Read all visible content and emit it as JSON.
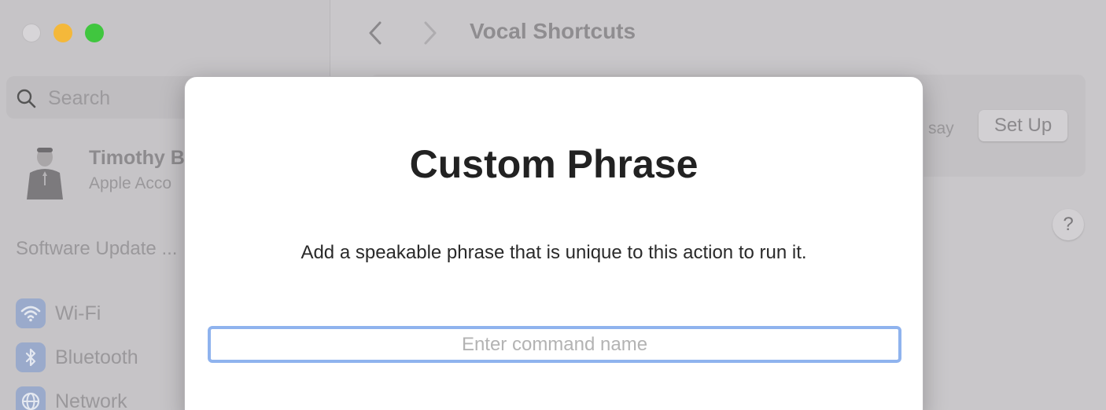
{
  "window": {
    "title": "Vocal Shortcuts"
  },
  "sidebar": {
    "search_placeholder": "Search",
    "user": {
      "name": "Timothy B",
      "subtitle": "Apple Acco"
    },
    "software_update": "Software Update ...",
    "items": [
      {
        "label": "Wi-Fi",
        "icon": "wifi-icon"
      },
      {
        "label": "Bluetooth",
        "icon": "bluetooth-icon"
      },
      {
        "label": "Network",
        "icon": "network-icon"
      }
    ]
  },
  "main": {
    "say_text": "say",
    "setup_label": "Set Up",
    "help_label": "?"
  },
  "dialog": {
    "title": "Custom Phrase",
    "description": "Add a speakable phrase that is unique to this action to run it.",
    "input_placeholder": "Enter command name",
    "input_value": ""
  },
  "colors": {
    "accent_focus": "#8fb3ee",
    "traffic_min": "#f4b83a",
    "traffic_max": "#40c63f"
  }
}
